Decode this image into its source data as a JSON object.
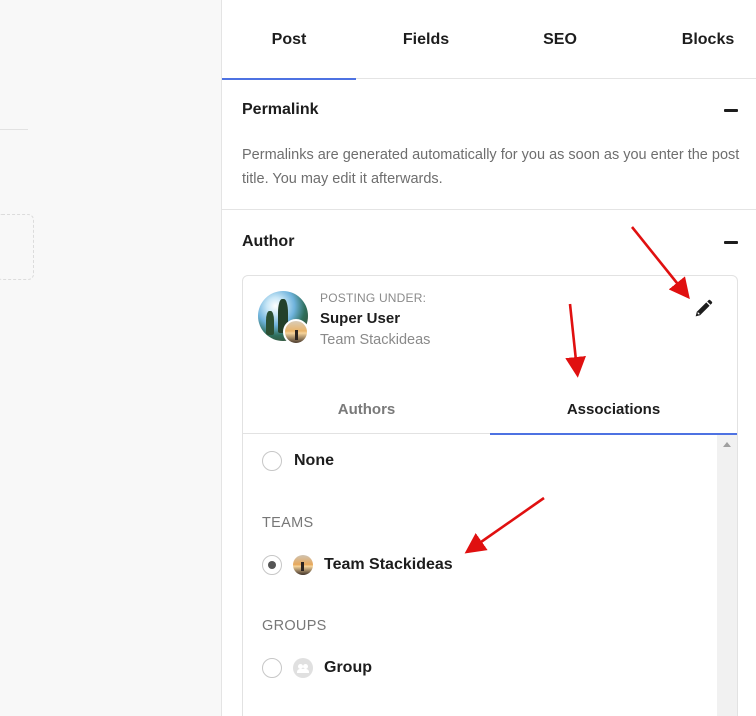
{
  "tabs": [
    {
      "label": "Post",
      "active": true
    },
    {
      "label": "Fields",
      "active": false
    },
    {
      "label": "SEO",
      "active": false
    },
    {
      "label": "Blocks",
      "active": false
    }
  ],
  "permalink": {
    "title": "Permalink",
    "description": "Permalinks are generated automatically for you as soon as you enter the post title. You may edit it afterwards."
  },
  "author": {
    "title": "Author",
    "posting_label": "POSTING UNDER:",
    "user_name": "Super User",
    "team_name": "Team Stackideas",
    "subtabs": [
      {
        "label": "Authors",
        "active": false
      },
      {
        "label": "Associations",
        "active": true
      }
    ],
    "options": {
      "none_label": "None",
      "teams_heading": "TEAMS",
      "team_option": "Team Stackideas",
      "groups_heading": "GROUPS",
      "group_option": "Group",
      "selected": "Team Stackideas"
    }
  },
  "colors": {
    "accent": "#4e72e2",
    "annotation_arrow": "#e01010"
  },
  "icons": [
    "collapse-minus-icon",
    "pencil-icon",
    "scroll-up-icon",
    "team-avatar-icon",
    "group-icon"
  ]
}
